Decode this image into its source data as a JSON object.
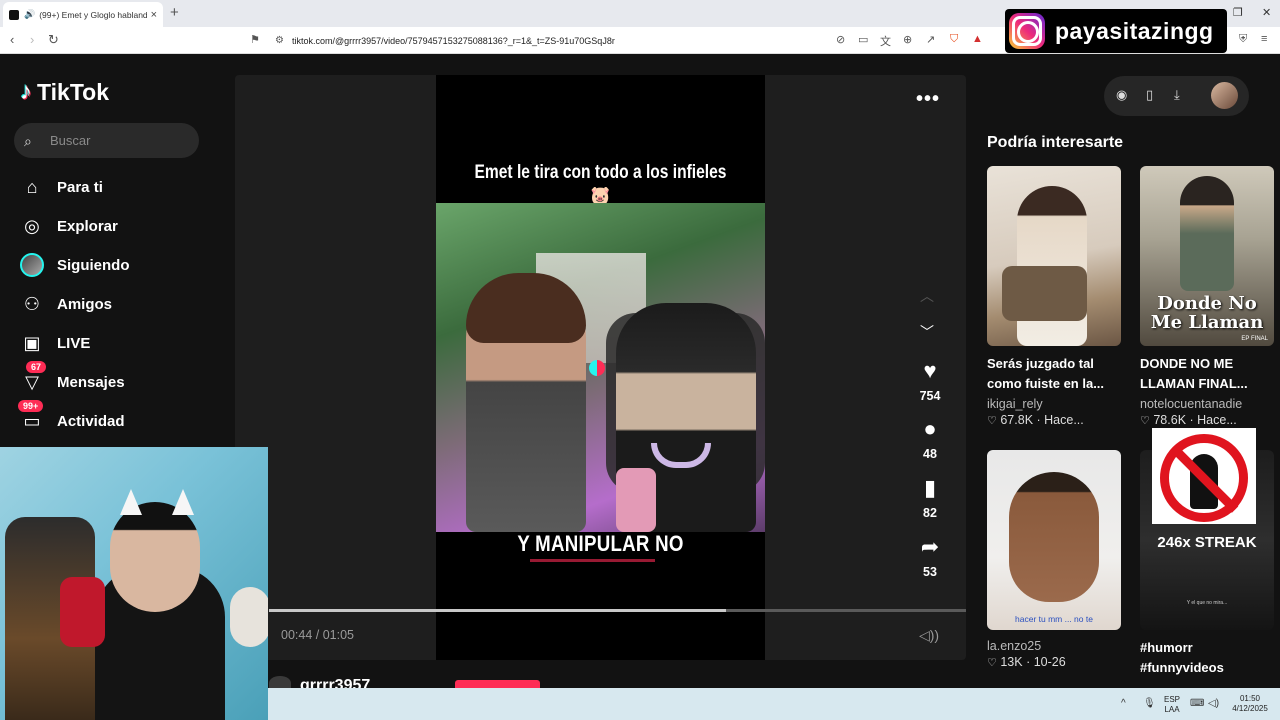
{
  "browser": {
    "tab_title": "(99+) Emet y Gloglo hablando",
    "tab_sound": "🔊",
    "url": "tiktok.com/@grrrr3957/video/7579457153275088136?_r=1&_t=ZS-91u70GSqJ8r"
  },
  "tiktok": {
    "logo": "TikTok",
    "search_placeholder": "Buscar",
    "nav": [
      {
        "label": "Para ti",
        "icon": "home-icon"
      },
      {
        "label": "Explorar",
        "icon": "compass-icon"
      },
      {
        "label": "Siguiendo",
        "icon": "following-avatar"
      },
      {
        "label": "Amigos",
        "icon": "friends-icon"
      },
      {
        "label": "LIVE",
        "icon": "live-tv-icon"
      },
      {
        "label": "Mensajes",
        "icon": "send-icon",
        "badge": "67"
      },
      {
        "label": "Actividad",
        "icon": "inbox-icon",
        "badge": "99+"
      }
    ]
  },
  "video": {
    "caption": "Emet le tira con todo a los infieles 🐷",
    "subtitle": "Y MANIPULAR NO",
    "time": "00:44 / 01:05",
    "progress": 0.655,
    "likes": "754",
    "comments": "48",
    "saves": "82",
    "shares": "53",
    "author": "grrrr3957"
  },
  "sidebar": {
    "title": "Podría interesarte",
    "items": [
      {
        "title": "Serás juzgado tal como fuiste en la...",
        "user": "ikigai_rely",
        "likes": "67.8K",
        "date": "Hace..."
      },
      {
        "title": "DONDE NO ME LLAMAN FINAL...",
        "user": "notelocuentanadie",
        "likes": "78.6K",
        "date": "Hace...",
        "thumb_text": "Donde No Me Llaman",
        "thumb_badge": "EP FINAL"
      },
      {
        "title": "",
        "user": "la.enzo25",
        "likes": "13K",
        "date": "10-26",
        "thumb_text": "hacer tu mm ... no te"
      },
      {
        "title": "#humorr #funnyvideos",
        "user": "",
        "likes": "",
        "date": "",
        "thumb_text": "246x STREAK",
        "thumb_small": "Y el que no mira..."
      }
    ]
  },
  "overlay": {
    "instagram_handle": "payasitazingg"
  },
  "taskbar": {
    "lang1": "ESP",
    "lang2": "LAA",
    "time": "01:50",
    "date": "4/12/2025"
  },
  "colors": {
    "accent": "#fe2c55",
    "cyan": "#25f4ee",
    "page_bg": "#121212"
  }
}
